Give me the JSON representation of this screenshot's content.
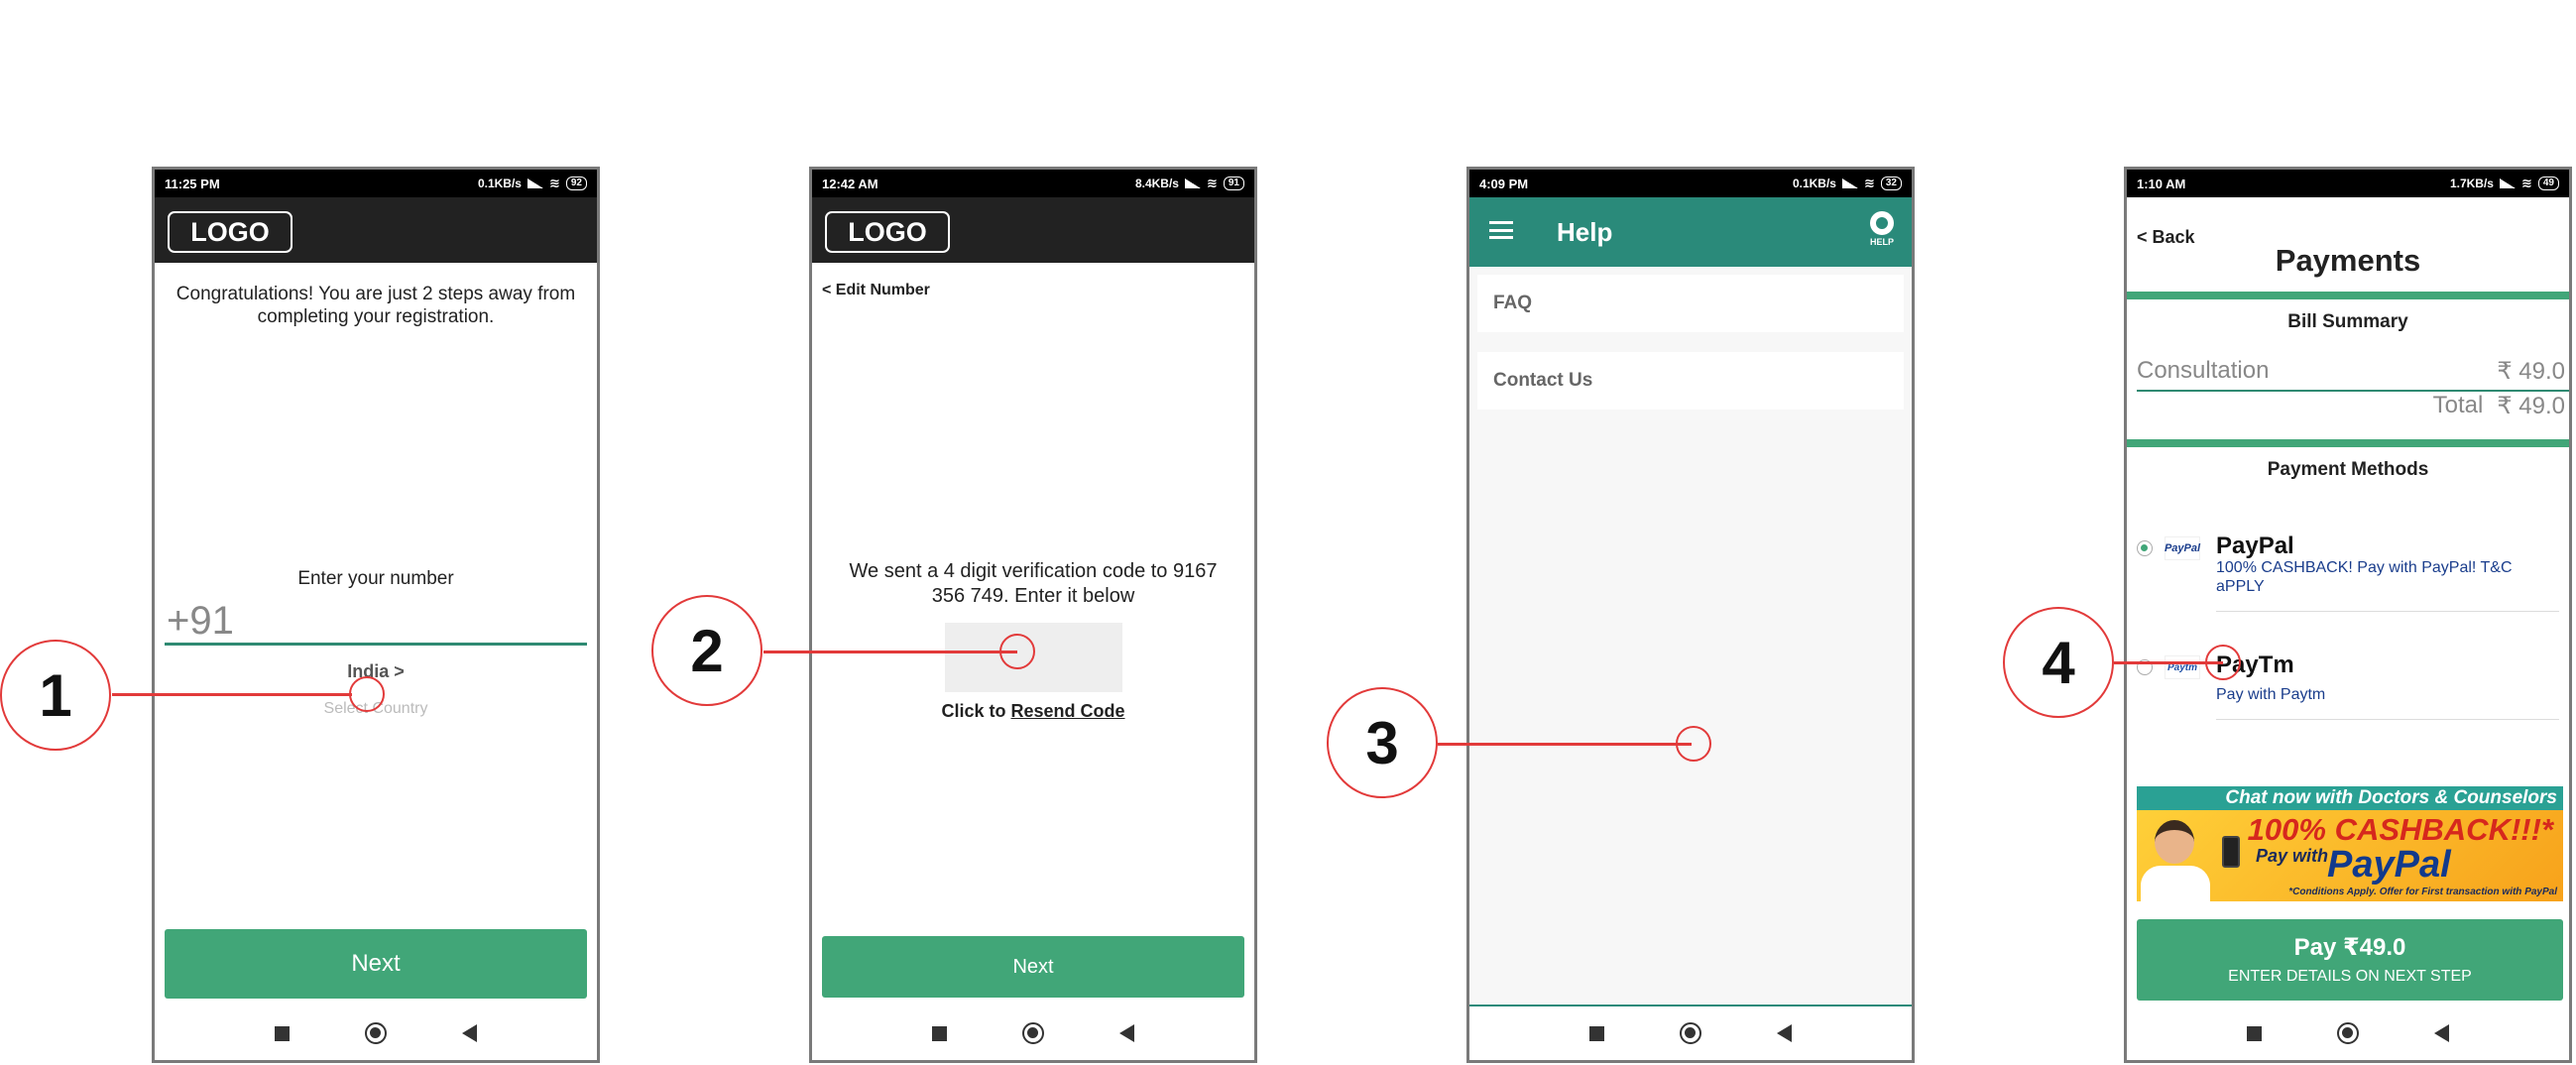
{
  "screen1": {
    "status": {
      "time": "11:25 PM",
      "speed": "0.1KB/s",
      "battery": "92"
    },
    "logo": "LOGO",
    "congrats": "Congratulations! You are just 2 steps away from completing your registration.",
    "enter_label": "Enter your number",
    "phone_prefix": "+91",
    "country": "India >",
    "select_country": "Select Country",
    "next": "Next"
  },
  "screen2": {
    "status": {
      "time": "12:42 AM",
      "speed": "8.4KB/s",
      "battery": "91"
    },
    "logo": "LOGO",
    "edit_number": "< Edit Number",
    "sent_text": "We sent a 4 digit verification code to 9167 356 749. Enter it below",
    "code_value": "",
    "resend_prefix": "Click to",
    "resend_link": "Resend Code",
    "next": "Next"
  },
  "screen3": {
    "status": {
      "time": "4:09 PM",
      "speed": "0.1KB/s",
      "battery": "32"
    },
    "title": "Help",
    "help_icon_label": "HELP",
    "items": [
      "FAQ",
      "Contact Us"
    ]
  },
  "screen4": {
    "status": {
      "time": "1:10 AM",
      "speed": "1.7KB/s",
      "battery": "49"
    },
    "back": "< Back",
    "title": "Payments",
    "bill_summary": "Bill Summary",
    "consultation_label": "Consultation",
    "consultation_value": "₹ 49.0",
    "total_label": "Total",
    "total_value": "₹ 49.0",
    "payment_methods": "Payment Methods",
    "methods": [
      {
        "name": "PayPal",
        "logo": "PayPal",
        "desc": "100% CASHBACK! Pay with PayPal! T&C aPPLY",
        "selected": true
      },
      {
        "name": "PayTm",
        "logo": "Paytm",
        "desc": "Pay with Paytm",
        "selected": false
      }
    ],
    "banner": {
      "top": "Chat now with Doctors & Counselors",
      "cashback": "100% CASHBACK!!!*",
      "pay_with": "Pay with",
      "paypal": "PayPal",
      "terms": "*Conditions Apply. Offer for First transaction with PayPal"
    },
    "pay_button": "Pay ₹49.0",
    "pay_sub": "ENTER DETAILS ON NEXT STEP"
  },
  "callouts": [
    "1",
    "2",
    "3",
    "4"
  ],
  "colors": {
    "accent": "#41a678",
    "header_teal": "#2a8a7a",
    "callout_red": "#e23a3a"
  }
}
